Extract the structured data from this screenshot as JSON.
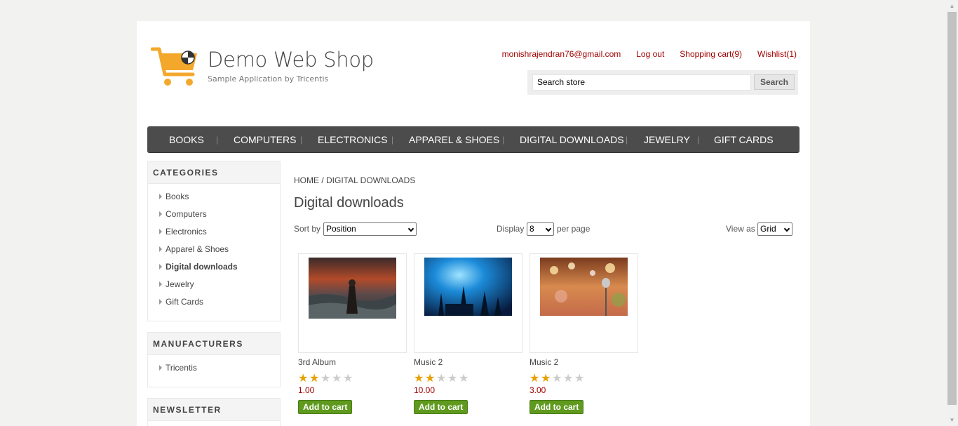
{
  "header": {
    "logo_title": "Demo Web Shop",
    "logo_subtitle": "Sample Application by Tricentis",
    "links": {
      "account": "monishrajendran76@gmail.com",
      "logout": "Log out",
      "cart": "Shopping cart(9)",
      "wishlist": "Wishlist(1)"
    },
    "search": {
      "value": "Search store",
      "button": "Search"
    }
  },
  "menu": [
    "BOOKS",
    "COMPUTERS",
    "ELECTRONICS",
    "APPAREL & SHOES",
    "DIGITAL DOWNLOADS",
    "JEWELRY",
    "GIFT CARDS"
  ],
  "sidebar": {
    "categories_title": "CATEGORIES",
    "categories": [
      "Books",
      "Computers",
      "Electronics",
      "Apparel & Shoes",
      "Digital downloads",
      "Jewelry",
      "Gift Cards"
    ],
    "active_category": "Digital downloads",
    "manufacturers_title": "MANUFACTURERS",
    "manufacturers": [
      "Tricentis"
    ],
    "newsletter_title": "NEWSLETTER"
  },
  "main": {
    "breadcrumb": "HOME / DIGITAL DOWNLOADS",
    "title": "Digital downloads",
    "sort_label": "Sort by",
    "sort_value": "Position",
    "display_label": "Display",
    "display_value": "8",
    "per_page_label": "per page",
    "view_label": "View as",
    "view_value": "Grid"
  },
  "products": [
    {
      "title": "3rd Album",
      "price": "1.00",
      "rating": 2,
      "button": "Add to cart"
    },
    {
      "title": "Music 2",
      "price": "10.00",
      "rating": 2,
      "button": "Add to cart"
    },
    {
      "title": "Music 2",
      "price": "3.00",
      "rating": 2,
      "button": "Add to cart"
    }
  ],
  "colors": {
    "link": "#a10000",
    "menu_bg": "#4c4c4c",
    "button_green": "#5f9a1f",
    "star": "#e8a000"
  }
}
